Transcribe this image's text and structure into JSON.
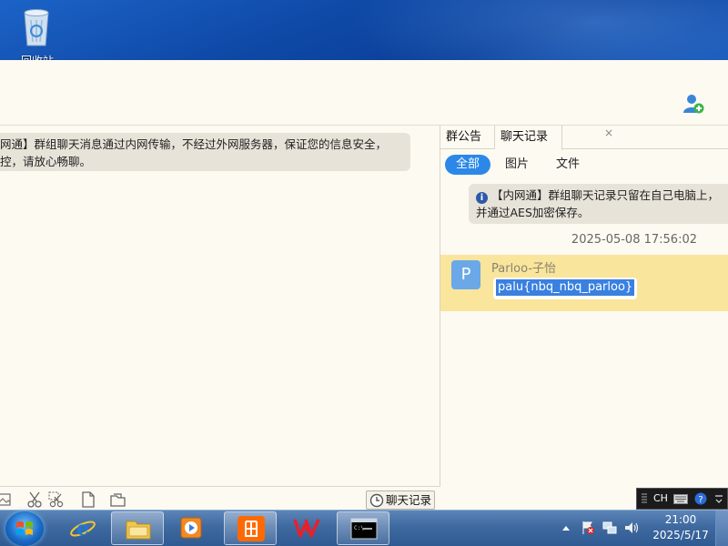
{
  "desktop": {
    "recycle_bin_label": "回收站"
  },
  "header": {
    "add_member_icon": "add-user-icon"
  },
  "chat": {
    "system_message_line1": "网通】群组聊天消息通过内网传输，不经过外网服务器，保证您的信息安全，",
    "system_message_line2": "控，请放心畅聊。",
    "history_button_label": "聊天记录"
  },
  "panel": {
    "tabs": [
      {
        "label": "群公告"
      },
      {
        "label": "聊天记录",
        "close": "×"
      }
    ],
    "filters": [
      {
        "label": "全部",
        "active": true
      },
      {
        "label": "图片"
      },
      {
        "label": "文件"
      }
    ],
    "notice_line1": "【内网通】群组聊天记录只留在自己电脑上，",
    "notice_line2": "并通过AES加密保存。",
    "timestamp": "2025-05-08 17:56:02",
    "message": {
      "avatar_letter": "P",
      "sender": "Parloo-子怡",
      "text": "palu{nbq_nbq_parloo}"
    }
  },
  "ime": {
    "lang": "CH"
  },
  "taskbar": {
    "clock_time": "21:00",
    "clock_date": "2025/5/17"
  },
  "colors": {
    "accent": "#2c88e8",
    "highlight_row": "#f9e59b",
    "selection": "#3a80e0"
  }
}
